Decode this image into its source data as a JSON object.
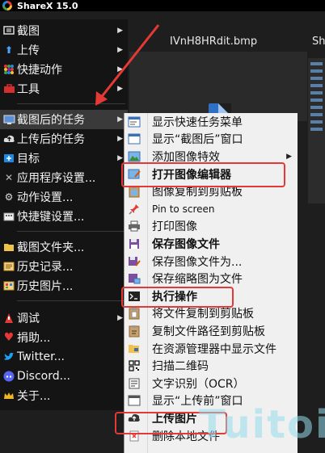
{
  "window": {
    "title": "ShareX 15.0"
  },
  "background": {
    "file_tab": "IVnH8HRdit.bmp",
    "file_tab2": "Sh"
  },
  "main_menu": {
    "items": [
      {
        "label": "截图",
        "icon": "screen-capture-icon",
        "has_submenu": true
      },
      {
        "label": "上传",
        "icon": "upload-arrow-icon",
        "has_submenu": true
      },
      {
        "label": "快捷动作",
        "icon": "grid-dots-icon",
        "has_submenu": true
      },
      {
        "label": "工具",
        "icon": "toolbox-icon",
        "has_submenu": true
      },
      {
        "label": "截图后的任务",
        "icon": "monitor-icon",
        "has_submenu": true,
        "highlighted": true
      },
      {
        "label": "上传后的任务",
        "icon": "cloud-upload-icon",
        "has_submenu": true
      },
      {
        "label": "目标",
        "icon": "target-icon",
        "has_submenu": true
      },
      {
        "label": "应用程序设置...",
        "icon": "wrench-icon",
        "has_submenu": false
      },
      {
        "label": "动作设置...",
        "icon": "gear-icon",
        "has_submenu": false
      },
      {
        "label": "快捷键设置...",
        "icon": "keyboard-icon",
        "has_submenu": false
      },
      {
        "label": "截图文件夹...",
        "icon": "folder-icon",
        "has_submenu": false
      },
      {
        "label": "历史记录...",
        "icon": "history-list-icon",
        "has_submenu": false
      },
      {
        "label": "历史图片...",
        "icon": "image-history-icon",
        "has_submenu": false
      },
      {
        "label": "调试",
        "icon": "debug-icon",
        "has_submenu": true
      },
      {
        "label": "捐助...",
        "icon": "heart-icon",
        "has_submenu": false
      },
      {
        "label": "Twitter...",
        "icon": "twitter-icon",
        "has_submenu": false
      },
      {
        "label": "Discord...",
        "icon": "discord-icon",
        "has_submenu": false
      },
      {
        "label": "关于...",
        "icon": "crown-icon",
        "has_submenu": false
      }
    ]
  },
  "sub_menu": {
    "items": [
      {
        "label": "显示快速任务菜单",
        "icon": "quick-menu-icon"
      },
      {
        "label": "显示“截图后”窗口",
        "icon": "window-icon"
      },
      {
        "label": "添加图像特效",
        "icon": "image-effects-icon",
        "has_submenu": true
      },
      {
        "label": "打开图像编辑器",
        "icon": "image-editor-icon",
        "bold": true,
        "boxed": true
      },
      {
        "label": "图像复制到剪贴板",
        "icon": "clipboard-image-icon"
      },
      {
        "label": "Pin to screen",
        "icon": "pin-icon"
      },
      {
        "label": "打印图像",
        "icon": "printer-icon"
      },
      {
        "label": "保存图像文件",
        "icon": "save-icon",
        "bold": true
      },
      {
        "label": "保存图像文件为...",
        "icon": "save-as-icon"
      },
      {
        "label": "保存缩略图为文件",
        "icon": "thumbnail-icon"
      },
      {
        "label": "执行操作",
        "icon": "terminal-icon",
        "bold": true,
        "boxed": true
      },
      {
        "label": "将文件复制到剪贴板",
        "icon": "copy-file-icon"
      },
      {
        "label": "复制文件路径到剪贴板",
        "icon": "copy-path-icon"
      },
      {
        "label": "在资源管理器中显示文件",
        "icon": "explorer-folder-icon"
      },
      {
        "label": "扫描二维码",
        "icon": "qr-code-icon"
      },
      {
        "label": "文字识别（OCR）",
        "icon": "ocr-icon"
      },
      {
        "label": "显示“上传前”窗口",
        "icon": "window-icon"
      },
      {
        "label": "上传图片",
        "icon": "cloud-upload-icon",
        "bold": true,
        "boxed": true
      },
      {
        "label": "删除本地文件",
        "icon": "delete-file-icon"
      }
    ]
  },
  "watermark": "Tuitoi",
  "colors": {
    "menu_dark": "#141414",
    "menu_light": "#f0f0f0",
    "highlight_box": "#e53935",
    "arrow": "#e53935"
  }
}
